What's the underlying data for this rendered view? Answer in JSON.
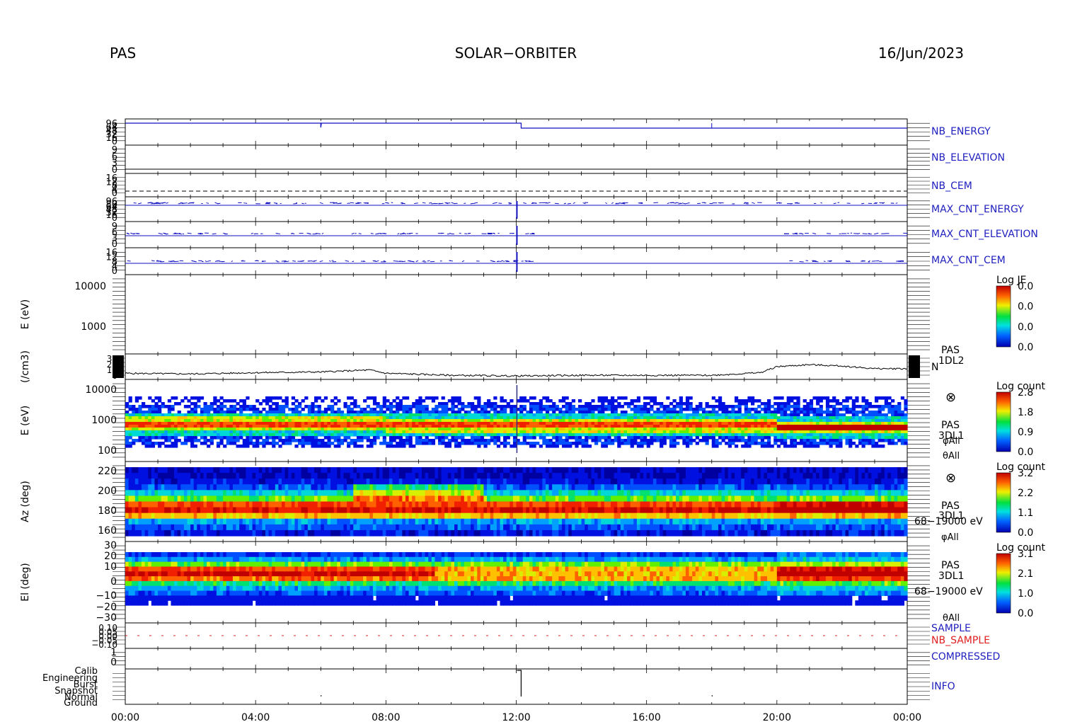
{
  "header": {
    "instrument": "PAS",
    "mission": "SOLAR−ORBITER",
    "date": "16/Jun/2023"
  },
  "time_axis": {
    "ticks": [
      "00:00",
      "04:00",
      "08:00",
      "12:00",
      "16:00",
      "20:00",
      "00:00"
    ],
    "hours": [
      0,
      4,
      8,
      12,
      16,
      20,
      24
    ]
  },
  "chart_data": [
    {
      "type": "line",
      "name": "NB_ENERGY",
      "label_color": "#2020c0",
      "ytick_labels": [
        "96",
        "64",
        "48",
        "32",
        "16",
        "0"
      ],
      "description_points": {
        "x_hours": [
          0,
          6,
          6.02,
          12.0,
          12.15,
          18,
          24
        ],
        "y": [
          96,
          96,
          80,
          96,
          64,
          64,
          64
        ]
      }
    },
    {
      "type": "line",
      "name": "NB_ELEVATION",
      "label_color": "#2020c0",
      "ytick_labels": [
        "9",
        "6",
        "3",
        "0"
      ]
    },
    {
      "type": "line",
      "name": "NB_CEM",
      "label_color": "#2020c0",
      "ytick_labels": [
        "16",
        "12",
        "8",
        "4",
        "0"
      ]
    },
    {
      "type": "line",
      "name": "MAX_CNT_ENERGY",
      "label_color": "#2020c0",
      "ytick_labels": [
        "96",
        "80",
        "64",
        "48",
        "32",
        "16",
        "0"
      ]
    },
    {
      "type": "line",
      "name": "MAX_CNT_ELEVATION",
      "label_color": "#2020c0",
      "ytick_labels": [
        "9",
        "6",
        "3",
        "0"
      ]
    },
    {
      "type": "line",
      "name": "MAX_CNT_CEM",
      "label_color": "#2020c0",
      "ytick_labels": [
        "16",
        "12",
        "8",
        "4",
        "0"
      ]
    },
    {
      "type": "heatmap",
      "ylabel": "E (eV)",
      "ytick_labels": [
        "10000",
        "1000"
      ],
      "colorbar": {
        "title": "Log JE",
        "ticks": [
          "0.0",
          "0.0",
          "0.0",
          "0.0"
        ]
      },
      "note": "empty panel"
    },
    {
      "type": "line",
      "ylabel": "(/cm3)",
      "series_label": "N",
      "product": [
        "PAS",
        "1DL2"
      ],
      "ytick_labels": [
        "30",
        "20",
        "10",
        "0"
      ],
      "x_hours": [
        0,
        2,
        4,
        6,
        7.5,
        8,
        10,
        12,
        14,
        16,
        18,
        19.5,
        20,
        21,
        22,
        23,
        24
      ],
      "values": [
        6,
        5,
        7,
        8,
        11,
        6,
        3,
        2,
        3,
        3,
        3,
        7,
        16,
        19,
        17,
        13,
        13
      ]
    },
    {
      "type": "heatmap",
      "ylabel": "E (eV)",
      "ytick_labels": [
        "10000",
        "1000",
        "100"
      ],
      "product": [
        "PAS",
        "3DL1",
        "φAll",
        "θAll"
      ],
      "colorbar": {
        "title": "Log count",
        "ticks": [
          "2.8",
          "1.8",
          "0.9",
          "0.0"
        ]
      }
    },
    {
      "type": "heatmap",
      "ylabel": "Az (deg)",
      "ytick_labels": [
        "220",
        "200",
        "180",
        "160"
      ],
      "product": [
        "PAS",
        "3DL1",
        "68−19000 eV",
        "φAll"
      ],
      "colorbar": {
        "title": "Log count",
        "ticks": [
          "3.2",
          "2.2",
          "1.1",
          "0.0"
        ]
      }
    },
    {
      "type": "heatmap",
      "ylabel": "El (deg)",
      "ytick_labels": [
        "30",
        "20",
        "10",
        "0",
        "−10",
        "−20",
        "−30"
      ],
      "product": [
        "PAS",
        "3DL1",
        "68−19000 eV",
        "θAll"
      ],
      "colorbar": {
        "title": "Log count",
        "ticks": [
          "3.1",
          "2.1",
          "1.0",
          "0.0"
        ]
      }
    },
    {
      "type": "line",
      "names": [
        "SAMPLE",
        "NB_SAMPLE"
      ],
      "name_colors": [
        "#2020c0",
        "#e02020"
      ],
      "ytick_labels": [
        "0.10",
        "0.05",
        "0.00",
        "−0.05",
        "−0.10"
      ]
    },
    {
      "type": "line",
      "name": "COMPRESSED",
      "label_color": "#2020c0",
      "ytick_labels": [
        "1",
        "0"
      ]
    },
    {
      "type": "line",
      "name": "INFO",
      "label_color": "#2020c0",
      "ytick_labels": [
        "Calib",
        "Engineering",
        "Burst",
        "Snapshot",
        "Normal",
        "Ground"
      ]
    }
  ]
}
